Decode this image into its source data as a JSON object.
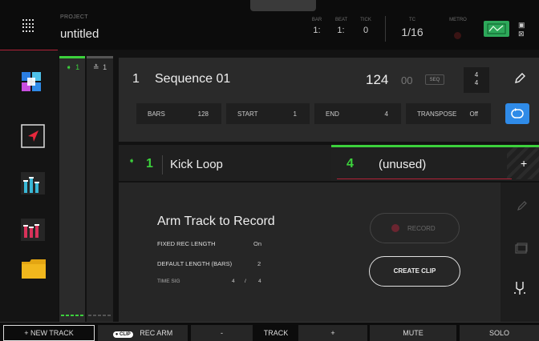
{
  "header": {
    "project_label": "PROJECT",
    "project_name": "untitled",
    "bar_label": "BAR",
    "bar_value": "1:",
    "beat_label": "BEAT",
    "beat_value": "1:",
    "tick_label": "TICK",
    "tick_value": "0",
    "tc_label": "TC",
    "tc_value": "1/16",
    "metro_label": "METRO"
  },
  "tracks": [
    {
      "icon": "➧",
      "number": "1",
      "active": true
    },
    {
      "icon": "≛",
      "number": "1",
      "active": false
    }
  ],
  "sequence": {
    "number": "1",
    "name": "Sequence 01",
    "bpm": "124",
    "bpm_decimal": "00",
    "seq_tag": "SEQ",
    "timesig_top": "4",
    "timesig_bottom": "4",
    "params": [
      {
        "label": "BARS",
        "value": "128"
      },
      {
        "label": "START",
        "value": "1"
      },
      {
        "label": "END",
        "value": "4"
      },
      {
        "label": "TRANSPOSE",
        "value": "Off"
      }
    ]
  },
  "clip": {
    "track_number": "1",
    "track_name": "Kick Loop",
    "slot_number": "4",
    "slot_name": "(unused)",
    "plus": "+"
  },
  "record": {
    "title": "Arm Track to Record",
    "fixed_label": "FIXED REC LENGTH",
    "fixed_value": "On",
    "default_label": "DEFAULT LENGTH (BARS)",
    "default_value": "2",
    "timesig_label": "TIME SIG",
    "timesig_num": "4",
    "timesig_slash": "/",
    "timesig_den": "4",
    "record_button": "RECORD",
    "create_button": "CREATE CLIP"
  },
  "footer": {
    "new_track": "+   NEW TRACK",
    "clip_chip": "● CLIP",
    "rec_arm": "REC ARM",
    "minus": "-",
    "track": "TRACK",
    "plus": "+",
    "mute": "MUTE",
    "solo": "SOLO"
  },
  "colors": {
    "accent_green": "#3cd13c",
    "accent_blue": "#2f8be8",
    "accent_red": "#b22238"
  }
}
